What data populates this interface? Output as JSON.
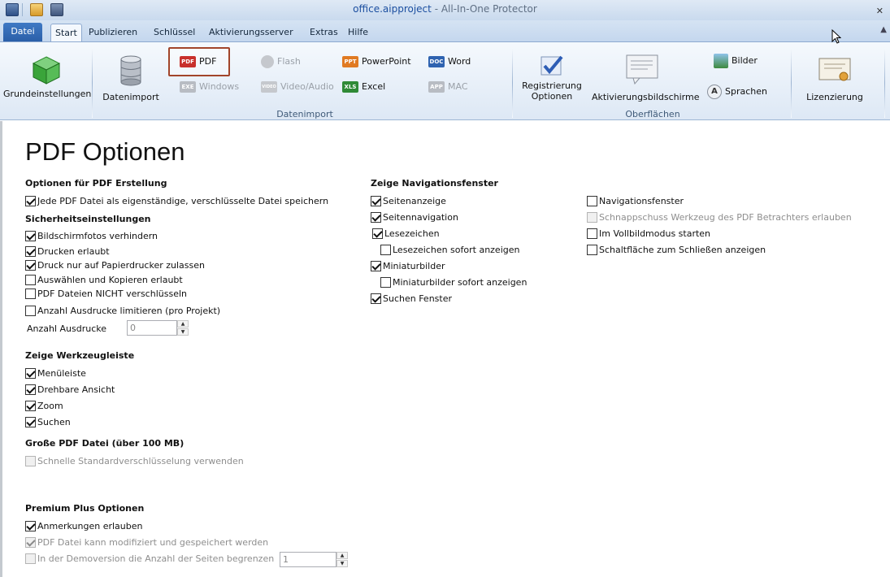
{
  "titlebar": {
    "app_name": "office.aipproject",
    "separator": " - ",
    "product": "All-In-One Protector",
    "close": "✕"
  },
  "tabs": {
    "file": "Datei",
    "start": "Start",
    "publish": "Publizieren",
    "keys": "Schlüssel",
    "activation_server": "Aktivierungsserver",
    "extras": "Extras",
    "help": "Hilfe"
  },
  "ribbon": {
    "basic_settings": "Grundeinstellungen",
    "data_import": "Datenimport",
    "pdf": "PDF",
    "windows": "Windows",
    "flash": "Flash",
    "video_audio": "Video/Audio",
    "powerpoint": "PowerPoint",
    "excel": "Excel",
    "word": "Word",
    "mac": "MAC",
    "registration_options_1": "Registrierung",
    "registration_options_2": "Optionen",
    "activation_screens": "Aktivierungsbildschirme",
    "images": "Bilder",
    "languages": "Sprachen",
    "licensing": "Lizenzierung",
    "group_import": "Datenimport",
    "group_surfaces": "Oberflächen",
    "icon_text_pdf": "PDF",
    "icon_text_exe": "EXE",
    "icon_text_ppt": "PPT",
    "icon_text_xls": "XLS",
    "icon_text_doc": "DOC",
    "icon_text_app": "APP",
    "icon_text_video": "VIDEO"
  },
  "page": {
    "title": "PDF Optionen",
    "pdf_creation": {
      "heading": "Optionen für PDF Erstellung",
      "each_separate": {
        "label": "Jede PDF Datei als eigenständige, verschlüsselte Datei speichern",
        "checked": true
      }
    },
    "security": {
      "heading": "Sicherheitseinstellungen",
      "items": [
        {
          "label": "Bildschirmfotos verhindern",
          "checked": true
        },
        {
          "label": "Drucken erlaubt",
          "checked": true
        },
        {
          "label": "Druck nur auf Papierdrucker zulassen",
          "checked": true
        },
        {
          "label": "Auswählen und Kopieren erlaubt",
          "checked": false
        },
        {
          "label": "PDF Dateien NICHT verschlüsseln",
          "checked": false
        },
        {
          "label": "Anzahl Ausdrucke limitieren (pro Projekt)",
          "checked": false
        }
      ],
      "print_count_label": "Anzahl Ausdrucke",
      "print_count_value": "0"
    },
    "toolbar": {
      "heading": "Zeige Werkzeugleiste",
      "items": [
        {
          "label": "Menüleiste",
          "checked": true
        },
        {
          "label": "Drehbare Ansicht",
          "checked": true
        },
        {
          "label": "Zoom",
          "checked": true
        },
        {
          "label": "Suchen",
          "checked": true
        }
      ]
    },
    "large_pdf": {
      "heading": "Große PDF Datei (über 100 MB)",
      "fast_encryption": {
        "label": "Schnelle Standardverschlüsselung verwenden",
        "checked": false,
        "disabled": true
      }
    },
    "premium": {
      "heading": "Premium Plus Optionen",
      "items": [
        {
          "label": "Anmerkungen erlauben",
          "checked": true,
          "disabled": false
        },
        {
          "label": "PDF Datei kann modifiziert und gespeichert werden",
          "checked": true,
          "disabled": true
        },
        {
          "label": "In der Demoversion die Anzahl der Seiten begrenzen",
          "checked": false,
          "disabled": true
        }
      ],
      "demo_pages_value": "1"
    },
    "navigation": {
      "heading": "Zeige Navigationsfenster",
      "col1": [
        {
          "label": "Seitenanzeige",
          "checked": true
        },
        {
          "label": "Seitennavigation",
          "checked": true
        },
        {
          "label": "Lesezeichen",
          "checked": true
        },
        {
          "label": "Lesezeichen sofort anzeigen",
          "checked": false
        },
        {
          "label": "Miniaturbilder",
          "checked": true
        },
        {
          "label": "Miniaturbilder sofort anzeigen",
          "checked": false
        },
        {
          "label": "Suchen Fenster",
          "checked": true
        }
      ],
      "col2": [
        {
          "label": "Navigationsfenster",
          "checked": false,
          "disabled": false
        },
        {
          "label": "Schnappschuss Werkzeug des PDF Betrachters erlauben",
          "checked": false,
          "disabled": true
        },
        {
          "label": "Im Vollbildmodus starten",
          "checked": false,
          "disabled": false
        },
        {
          "label": "Schaltfläche zum Schließen anzeigen",
          "checked": false,
          "disabled": false
        }
      ]
    }
  }
}
